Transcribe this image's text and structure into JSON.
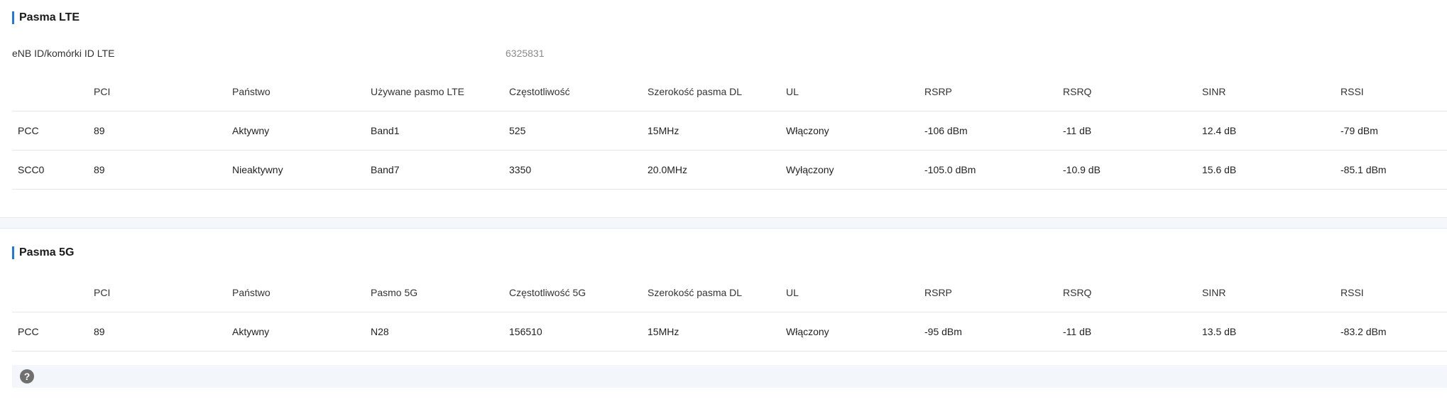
{
  "lte": {
    "title": "Pasma LTE",
    "enb_label": "eNB ID/komórki ID LTE",
    "enb_value": "6325831",
    "headers": [
      "",
      "PCI",
      "Państwo",
      "Używane pasmo LTE",
      "Częstotliwość",
      "Szerokość pasma DL",
      "UL",
      "RSRP",
      "RSRQ",
      "SINR",
      "RSSI"
    ],
    "rows": [
      [
        "PCC",
        "89",
        "Aktywny",
        "Band1",
        "525",
        "15MHz",
        "Włączony",
        "-106 dBm",
        "-11 dB",
        "12.4 dB",
        "-79 dBm"
      ],
      [
        "SCC0",
        "89",
        "Nieaktywny",
        "Band7",
        "3350",
        "20.0MHz",
        "Wyłączony",
        "-105.0 dBm",
        "-10.9 dB",
        "15.6 dB",
        "-85.1 dBm"
      ]
    ]
  },
  "nr": {
    "title": "Pasma 5G",
    "headers": [
      "",
      "PCI",
      "Państwo",
      "Pasmo 5G",
      "Częstotliwość 5G",
      "Szerokość pasma DL",
      "UL",
      "RSRP",
      "RSRQ",
      "SINR",
      "RSSI"
    ],
    "rows": [
      [
        "PCC",
        "89",
        "Aktywny",
        "N28",
        "156510",
        "15MHz",
        "Włączony",
        "-95 dBm",
        "-11 dB",
        "13.5 dB",
        "-83.2 dBm"
      ]
    ]
  },
  "help": {
    "icon_glyph": "?",
    "icon": "help-icon"
  }
}
